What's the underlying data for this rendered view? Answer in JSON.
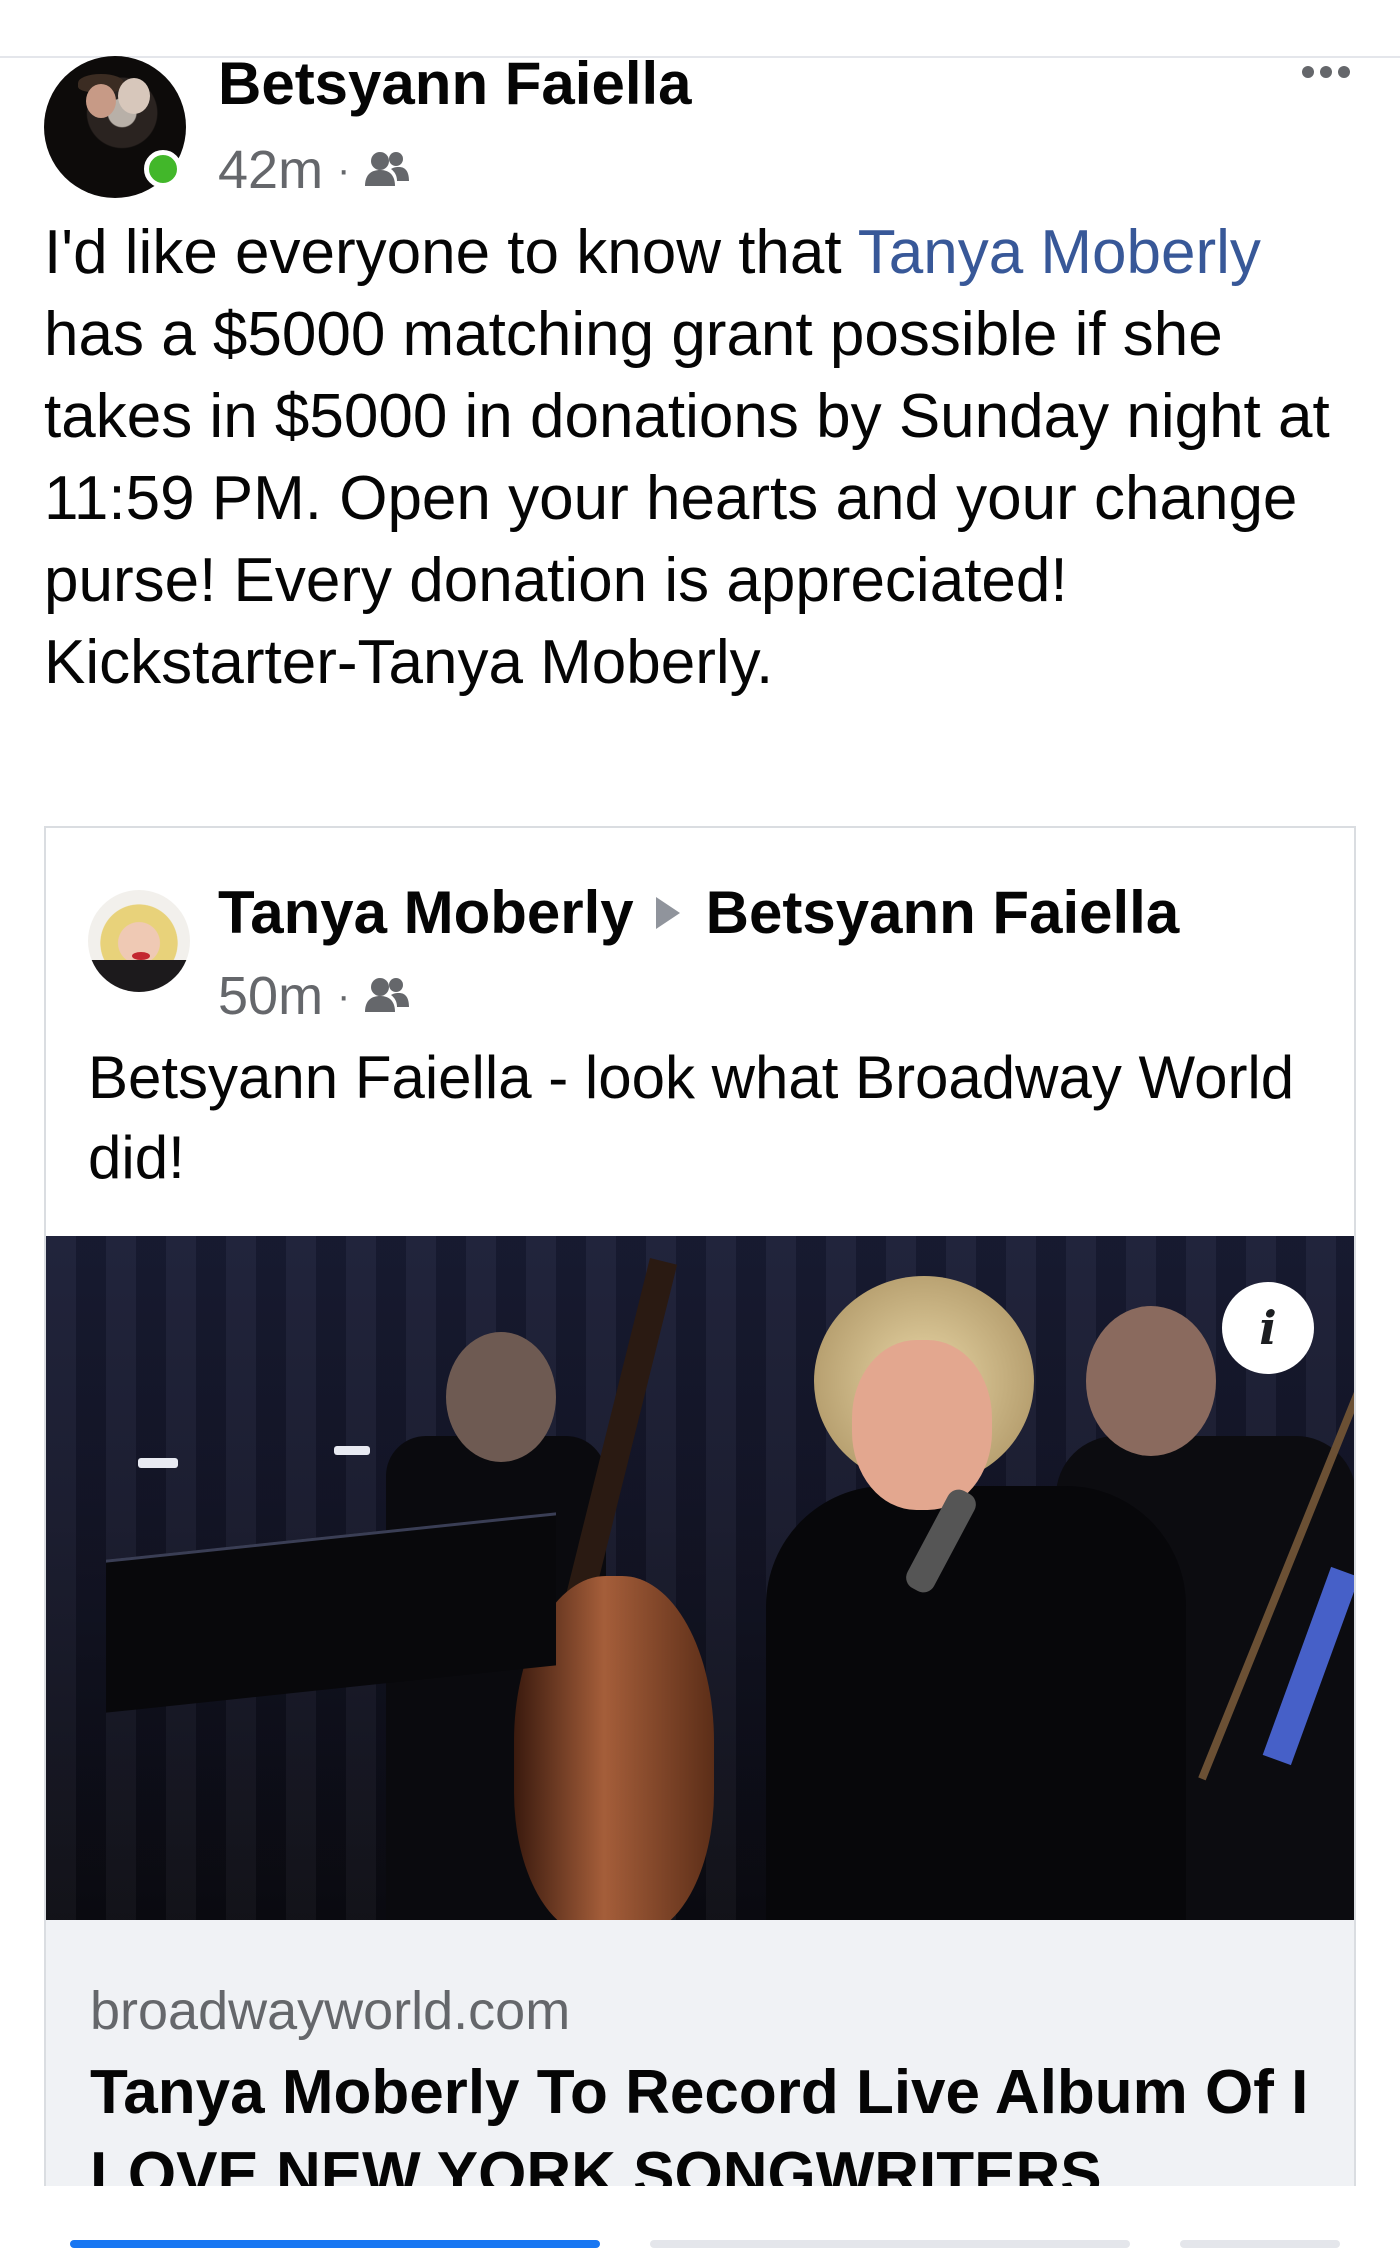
{
  "post": {
    "author": "Betsyann Faiella",
    "time": "42m",
    "separator": "·",
    "audience_icon": "friends-icon",
    "text_before_mention": "I'd like everyone to know that ",
    "mention": "Tanya Moberly",
    "text_after_mention": " has a $5000 matching grant possible if she takes in $5000 in donations by Sunday night at 11:59 PM. Open your hearts and your change purse! Every donation is appreciated! Kickstarter-Tanya Moberly.",
    "more_icon": "more-options-icon"
  },
  "shared_post": {
    "author": "Tanya Moberly",
    "target": "Betsyann Faiella",
    "time": "50m",
    "separator": "·",
    "text": "Betsyann Faiella - look what Broadway World did!",
    "info_label": "i"
  },
  "link_preview": {
    "domain": "broadwayworld.com",
    "title": "Tanya Moberly To Record Live Album Of I LOVE NEW YORK SONGWRITERS"
  },
  "colors": {
    "mention": "#385898",
    "meta": "#65676b",
    "online": "#42b72a",
    "card_footer": "#f0f2f5"
  }
}
